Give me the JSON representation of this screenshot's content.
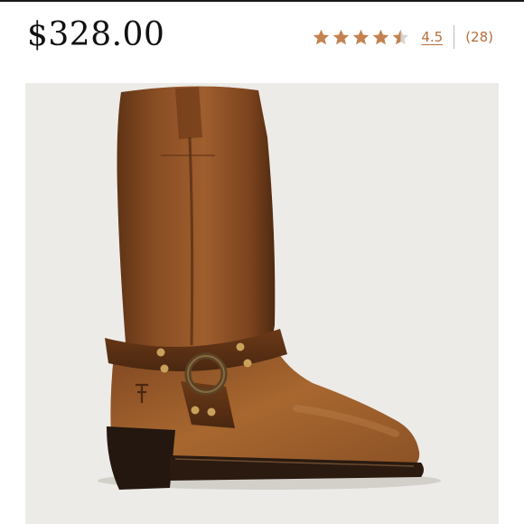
{
  "product": {
    "price": "$328.00",
    "image_icon": "harness-boot-photo",
    "leather_color": "#8a4e24",
    "background_color": "#ecebe7"
  },
  "rating": {
    "value": "4.5",
    "count": "(28)",
    "stars_filled": 4.5,
    "stars_total": 5,
    "star_color": "#c3824f",
    "star_empty_color": "#d9d4cf"
  }
}
